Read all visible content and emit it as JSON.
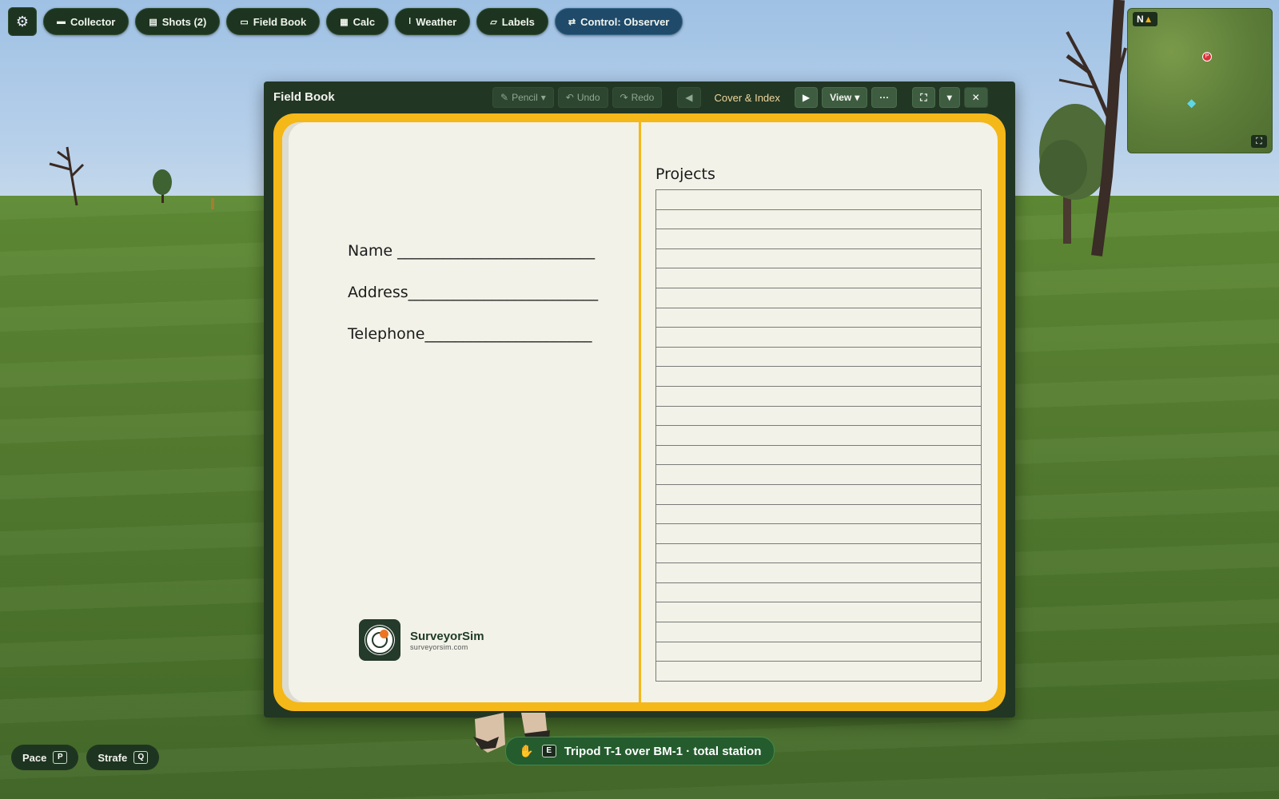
{
  "topbar": {
    "settings_icon": "gear-icon",
    "buttons": [
      {
        "label": "Collector",
        "icon": "collector-icon"
      },
      {
        "label": "Shots (2)",
        "icon": "shots-icon"
      },
      {
        "label": "Field Book",
        "icon": "book-icon"
      },
      {
        "label": "Calc",
        "icon": "calculator-icon"
      },
      {
        "label": "Weather",
        "icon": "thermometer-icon"
      },
      {
        "label": "Labels",
        "icon": "label-icon"
      },
      {
        "label": "Control: Observer",
        "icon": "swap-icon"
      }
    ]
  },
  "minimap": {
    "north_label": "N"
  },
  "window": {
    "title": "Field Book",
    "toolbar": {
      "pencil": "Pencil",
      "undo": "Undo",
      "redo": "Redo",
      "page_label": "Cover & Index",
      "view": "View",
      "more": "···"
    }
  },
  "book": {
    "left": {
      "name_line": "Name __________________________",
      "address_line": "Address_________________________",
      "telephone_line": "Telephone______________________",
      "logo_name": "SurveyorSim",
      "logo_url": "surveyorsim.com"
    },
    "right": {
      "title": "Projects",
      "row_count": 25
    }
  },
  "bottom": {
    "pace": {
      "label": "Pace",
      "key": "P"
    },
    "strafe": {
      "label": "Strafe",
      "key": "Q"
    }
  },
  "hint": {
    "key": "E",
    "text": "Tripod T-1 over BM-1 · total station"
  },
  "colors": {
    "book_cover": "#f5b819",
    "page": "#f2f2e8",
    "ui_dark_green": "#1d3520",
    "control_blue": "#1f4a6a",
    "sky": "#b7d0ea",
    "grass": "#577f31"
  }
}
